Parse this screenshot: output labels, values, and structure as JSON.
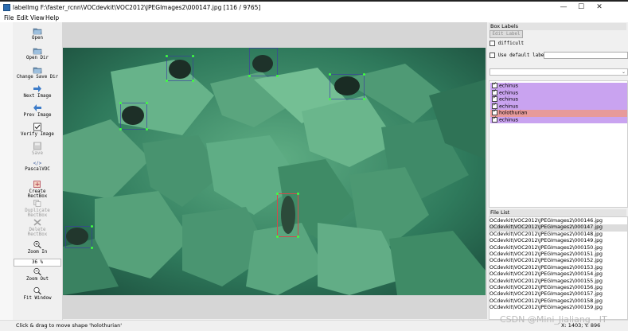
{
  "window": {
    "title": "labelImg F:\\faster_rcnn\\VOCdevkit\\VOC2012\\JPEGImages2\\000147.jpg [116 / 9765]",
    "minimize": "—",
    "maximize": "☐",
    "close": "✕"
  },
  "menu": {
    "file": "File",
    "edit": "Edit",
    "view": "View",
    "help": "Help"
  },
  "toolbar": {
    "open": "Open",
    "open_dir": "Open Dir",
    "change_save_dir": "Change Save Dir",
    "next_image": "Next Image",
    "prev_image": "Prev Image",
    "verify_image": "Verify Image",
    "save": "Save",
    "format_glyph": "</>",
    "format": "PascalVOC",
    "create_rectbox": "Create\nRectBox",
    "duplicate_rectbox": "Duplicate\nRectBox",
    "delete_rectbox": "Delete\nRectBox",
    "zoom_in": "Zoom In",
    "zoom_value": "36 %",
    "zoom_out": "Zoom Out",
    "fit_window": "Fit Window"
  },
  "box_labels": {
    "header": "Box Labels",
    "edit_label": "Edit Label",
    "difficult": "difficult",
    "use_default_label": "Use default label",
    "items": [
      {
        "label": "echinus",
        "color": "#c9a3f0"
      },
      {
        "label": "echinus",
        "color": "#c9a3f0"
      },
      {
        "label": "echinus",
        "color": "#c9a3f0"
      },
      {
        "label": "echinus",
        "color": "#c9a3f0"
      },
      {
        "label": "holothurian",
        "color": "#e79a9a"
      },
      {
        "label": "echinus",
        "color": "#c9a3f0"
      }
    ]
  },
  "file_list": {
    "header": "File List",
    "selected_index": 1,
    "items": [
      "OCdevkit\\VOC2012\\JPEGImages2\\000146.jpg",
      "OCdevkit\\VOC2012\\JPEGImages2\\000147.jpg",
      "OCdevkit\\VOC2012\\JPEGImages2\\000148.jpg",
      "OCdevkit\\VOC2012\\JPEGImages2\\000149.jpg",
      "OCdevkit\\VOC2012\\JPEGImages2\\000150.jpg",
      "OCdevkit\\VOC2012\\JPEGImages2\\000151.jpg",
      "OCdevkit\\VOC2012\\JPEGImages2\\000152.jpg",
      "OCdevkit\\VOC2012\\JPEGImages2\\000153.jpg",
      "OCdevkit\\VOC2012\\JPEGImages2\\000154.jpg",
      "OCdevkit\\VOC2012\\JPEGImages2\\000155.jpg",
      "OCdevkit\\VOC2012\\JPEGImages2\\000156.jpg",
      "OCdevkit\\VOC2012\\JPEGImages2\\000157.jpg",
      "OCdevkit\\VOC2012\\JPEGImages2\\000158.jpg",
      "OCdevkit\\VOC2012\\JPEGImages2\\000159.jpg"
    ]
  },
  "status": {
    "message": "Click & drag to move shape 'holothurian'",
    "coords": "X: 1403; Y: 896"
  },
  "watermark": "CSDN @Mini_Jialiang__IT",
  "colors": {
    "echinus": "#c9a3f0",
    "holothurian": "#e79a9a",
    "handle": "#3fff3f"
  }
}
